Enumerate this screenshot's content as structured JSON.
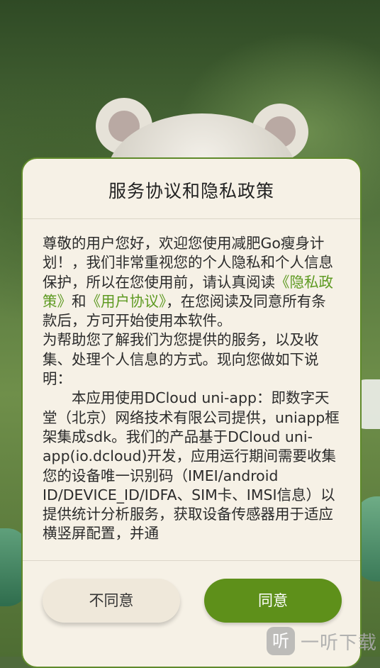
{
  "dialog": {
    "title": "服务协议和隐私政策",
    "intro_prefix": "尊敬的用户您好，欢迎您使用减肥Go瘦身计划！，我们非常重视您的个人隐私和个人信息保护，所以在您使用前，请认真阅读",
    "privacy_link": "《隐私政策》",
    "conj": "和",
    "user_link": "《用户协议》",
    "intro_suffix": "，在您阅读及同意所有条款后，方可开始使用本软件。",
    "para2": "为帮助您了解我们为您提供的服务，以及收集、处理个人信息的方式。现向您做如下说明：",
    "para3": "本应用使用DCloud uni-app：即数字天堂（北京）网络技术有限公司提供，uniapp框架集成sdk。我们的产品基于DCloud uni-app(io.dcloud)开发，应用运行期间需要收集您的设备唯一识别码（IMEI/android ID/DEVICE_ID/IDFA、SIM卡、IMSI信息）以提供统计分析服务，获取设备传感器用于适应横竖屏配置，并通",
    "disagree_label": "不同意",
    "agree_label": "同意"
  },
  "watermark": {
    "logo_glyph": "听",
    "text": "一听下载"
  },
  "colors": {
    "accent": "#5e901a",
    "link": "#5e9a22",
    "dialog_bg": "#f6f1e6",
    "dialog_border": "#5f8a2a"
  }
}
